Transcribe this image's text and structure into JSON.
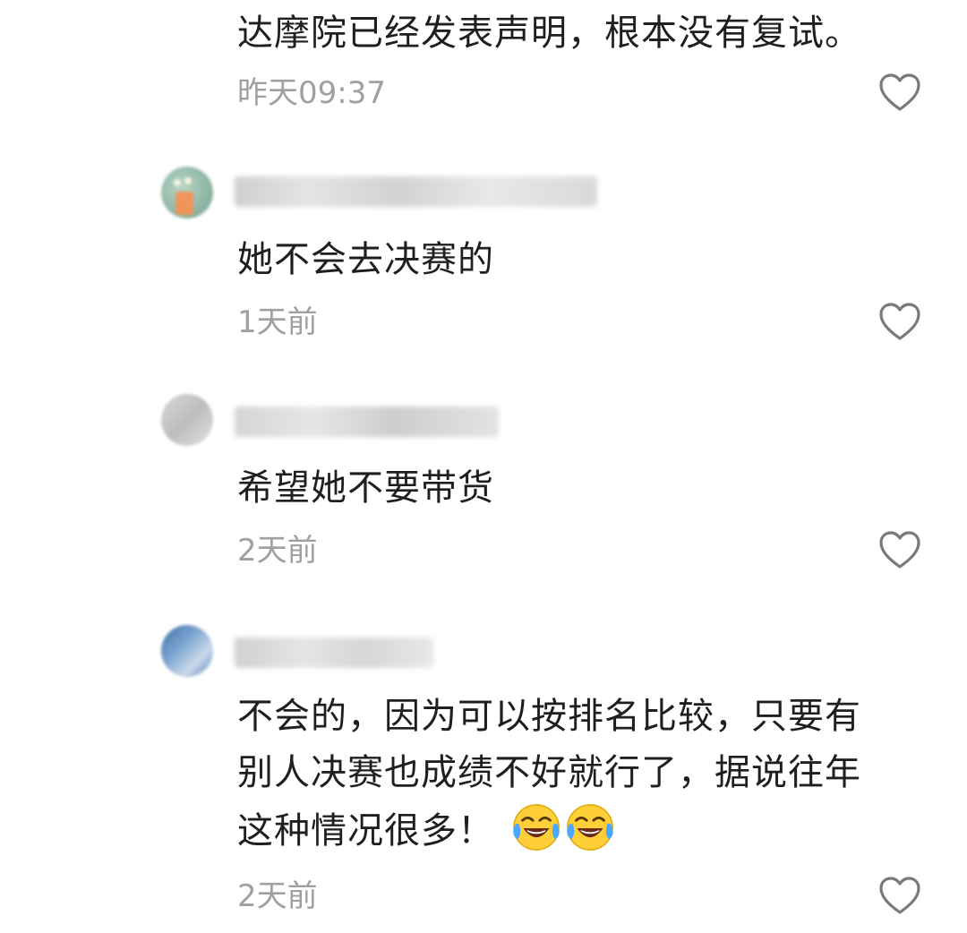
{
  "comments": [
    {
      "text": "达摩院已经发表声明，根本没有复试。",
      "time": "昨天09:37"
    },
    {
      "text": "她不会去决赛的",
      "time": "1天前"
    },
    {
      "text": "希望她不要带货",
      "time": "2天前"
    },
    {
      "lines": [
        "不会的，因为可以按排名比较，只要有",
        "别人决赛也成绩不好就行了，据说往年",
        "这种情况很多！"
      ],
      "emojis": [
        "tears-of-joy-emoji",
        "tears-of-joy-emoji"
      ],
      "time": "2天前"
    }
  ],
  "icons": {
    "like": "heart-outline-icon"
  },
  "colors": {
    "text": "#1f1f1f",
    "meta": "#a0a0a0",
    "heart": "#7a7a7a"
  }
}
